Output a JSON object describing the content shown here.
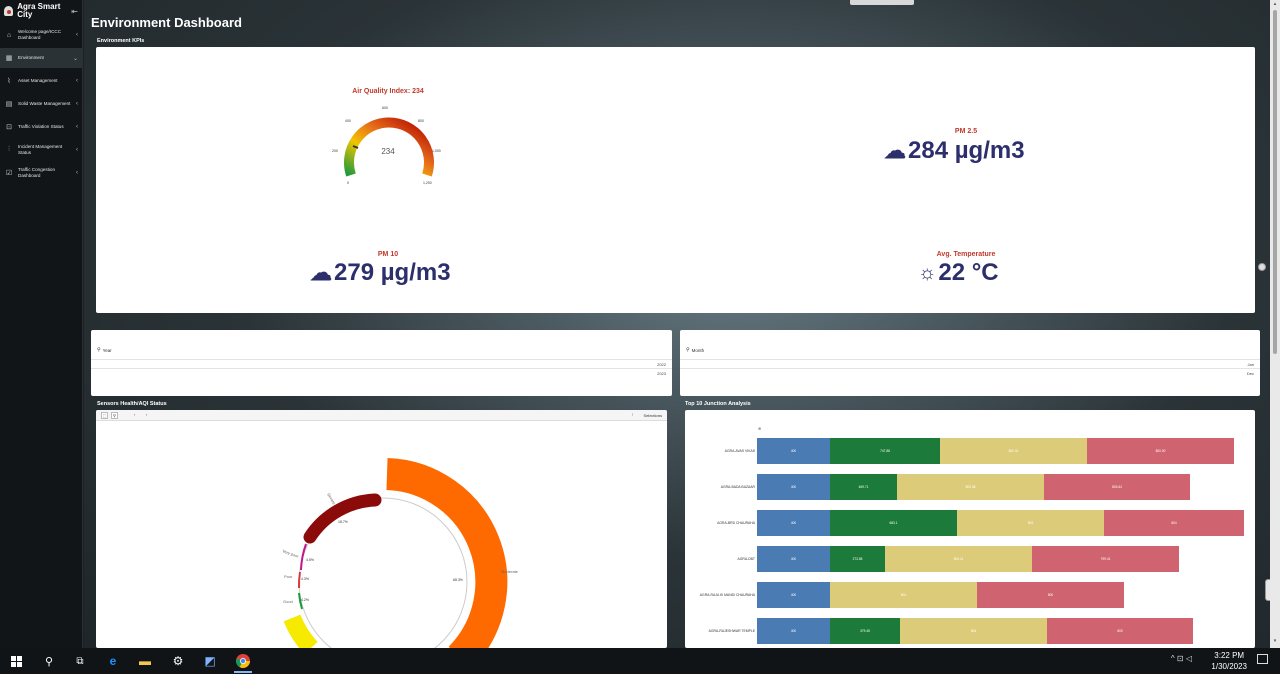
{
  "sidebar": {
    "brand": "Agra Smart City",
    "items": [
      {
        "label": "Welcome page/ICCC Dashboard",
        "icon": "home-icon",
        "glyph": "⌂",
        "chevron": "‹"
      },
      {
        "label": "Environment",
        "icon": "grid-icon",
        "glyph": "▦",
        "chevron": "⌄",
        "active": true
      },
      {
        "label": "Asset Management",
        "icon": "chart-icon",
        "glyph": "⌇",
        "chevron": "‹"
      },
      {
        "label": "Solid Waste Management",
        "icon": "waste-icon",
        "glyph": "▤",
        "chevron": "‹"
      },
      {
        "label": "Traffic Violation Status",
        "icon": "lock-icon",
        "glyph": "⊡",
        "chevron": "‹"
      },
      {
        "label": "Incident Management Status",
        "icon": "bar-icon",
        "glyph": "⫶",
        "chevron": "‹"
      },
      {
        "label": "Traffic Congestion Dashboard",
        "icon": "check-icon",
        "glyph": "☑",
        "chevron": "‹"
      }
    ],
    "collapse_glyph": "⇤"
  },
  "page": {
    "title": "Environment Dashboard"
  },
  "kpis": {
    "section": "Environment KPIs",
    "aqi_title": "Air Quality Index: 234",
    "aqi_value": "234",
    "aqi_ticks": [
      "0",
      "200",
      "400",
      "600",
      "800",
      "1,000",
      "1,200"
    ],
    "pm25_title": "PM 2.5",
    "pm25_value": "284 µg/m3",
    "pm10_title": "PM 10",
    "pm10_value": "279 µg/m3",
    "temp_title": "Avg. Temperature",
    "temp_value": "22 °C"
  },
  "filters": {
    "year": {
      "label": "Year",
      "options": [
        "2022",
        "2023"
      ]
    },
    "month": {
      "label": "Month",
      "options": [
        "Jan",
        "Dec"
      ]
    }
  },
  "sensors": {
    "section": "Sensors Health/AQI Status",
    "selections": "Selections",
    "donut_labels": [
      "Severe",
      "Very poor",
      "Poor",
      "Good",
      "Moderate"
    ],
    "donut_values": [
      "18.7%",
      "4.5%",
      "4.3%",
      "4.2%",
      "68.3%"
    ]
  },
  "junctions": {
    "section": "Top 10 Junction Analysis",
    "rows": [
      {
        "name": "AGRA-AVAS VIKAS",
        "segs": [
          "400",
          "747.88",
          "800.31",
          "800.00"
        ]
      },
      {
        "name": "AGRA-BADA BAZAAR",
        "segs": [
          "400",
          "469.71",
          "803.38",
          "803.64"
        ]
      },
      {
        "name": "AGRA-BRD CHAURAHA",
        "segs": [
          "400",
          "683.1",
          "804",
          "804"
        ]
      },
      {
        "name": "AGRA-DBT",
        "segs": [
          "400",
          "273.85",
          "804.11",
          "799.41"
        ]
      },
      {
        "name": "AGRA-RAJA KI MANDI CHAURAHA",
        "segs": [
          "400",
          "801",
          "800"
        ]
      },
      {
        "name": "AGRA-RAJESHWAR TEMPLE",
        "segs": [
          "400",
          "379.45",
          "804",
          "800"
        ]
      }
    ]
  },
  "colors": {
    "blue": "#4b7bb3",
    "green": "#1c7a3a",
    "khaki": "#dccb79",
    "red": "#cf6470",
    "orange": "#ff6a00",
    "darkred": "#8b0a0a",
    "navy": "#2c2f6b"
  },
  "taskbar": {
    "time": "3:22 PM",
    "date": "1/30/2023"
  }
}
